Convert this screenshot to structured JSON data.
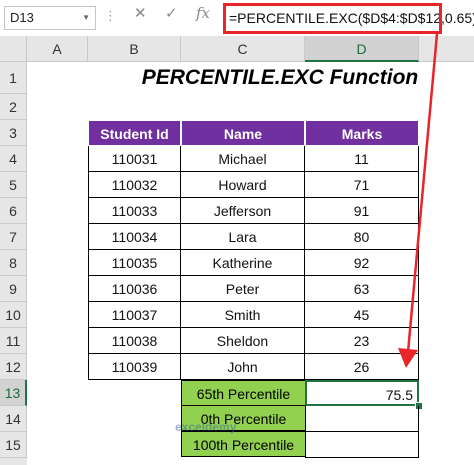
{
  "formula_bar": {
    "name_box": "D13",
    "cancel_label": "✕",
    "enter_label": "✓",
    "fx_label": "fx",
    "formula": "=PERCENTILE.EXC($D$4:$D$12,0.65)"
  },
  "columns": [
    "A",
    "B",
    "C",
    "D"
  ],
  "rows": [
    "1",
    "2",
    "3",
    "4",
    "5",
    "6",
    "7",
    "8",
    "9",
    "10",
    "11",
    "12",
    "13",
    "14",
    "15"
  ],
  "sheet": {
    "title": "PERCENTILE.EXC Function",
    "headers": {
      "id": "Student Id",
      "name": "Name",
      "marks": "Marks"
    },
    "records": [
      {
        "id": "110031",
        "name": "Michael",
        "marks": "11"
      },
      {
        "id": "110032",
        "name": "Howard",
        "marks": "71"
      },
      {
        "id": "110033",
        "name": "Jefferson",
        "marks": "91"
      },
      {
        "id": "110034",
        "name": "Lara",
        "marks": "80"
      },
      {
        "id": "110035",
        "name": "Katherine",
        "marks": "92"
      },
      {
        "id": "110036",
        "name": "Peter",
        "marks": "63"
      },
      {
        "id": "110037",
        "name": "Smith",
        "marks": "45"
      },
      {
        "id": "110038",
        "name": "Sheldon",
        "marks": "23"
      },
      {
        "id": "110039",
        "name": "John",
        "marks": "26"
      }
    ],
    "percentiles": [
      {
        "label": "65th Percentile",
        "value": "75.5"
      },
      {
        "label": "0th Percentile",
        "value": ""
      },
      {
        "label": "100th Percentile",
        "value": ""
      }
    ]
  },
  "watermark": "exceldemy",
  "colors": {
    "header_bg": "#7030a0",
    "label_bg": "#92d050",
    "highlight": "#e8262a",
    "excel_green": "#217346"
  }
}
